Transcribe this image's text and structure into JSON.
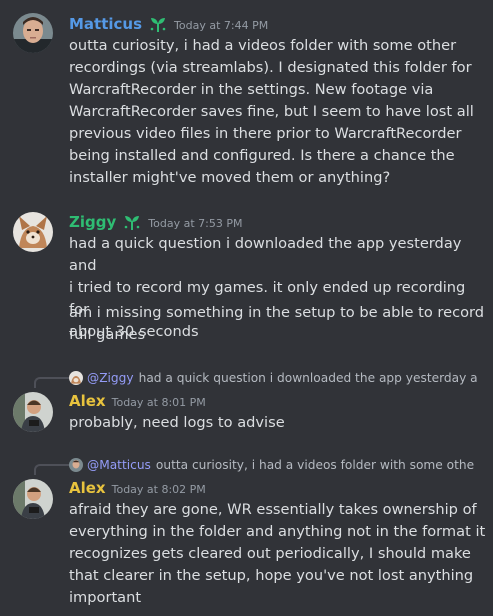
{
  "colors": {
    "background": "#313338",
    "matticus": "#5599e6",
    "ziggy": "#2fbd73",
    "alex": "#e8c33e",
    "timestamp": "#949ba4",
    "text": "#dbdee1",
    "mention": "#949cf7"
  },
  "messages": [
    {
      "author": "Matticus",
      "badge": "sprout-icon",
      "timestamp": "Today at 7:44 PM",
      "lines": [
        "outta curiosity, i had a videos folder with some other",
        "recordings (via streamlabs). I designated this folder for",
        "WarcraftRecorder in the settings. New footage via",
        "WarcraftRecorder saves fine, but I seem to have lost all",
        "previous video files in there prior to WarcraftRecorder",
        "being installed and configured. Is there a chance the",
        "installer might've moved them or anything?"
      ]
    },
    {
      "author": "Ziggy",
      "badge": "sprout-icon",
      "timestamp": "Today at 7:53 PM",
      "lines": [
        "had a quick question i downloaded the app yesterday and",
        "i tried to record my games. it only ended up recording for",
        "about 30 seconds"
      ],
      "followup": [
        "am i missing something in the setup to be able to record",
        "full games"
      ]
    },
    {
      "author": "Alex",
      "timestamp": "Today at 8:01 PM",
      "reply_to": {
        "name": "@Ziggy",
        "text": "had a quick question i downloaded the app yesterday a"
      },
      "lines": [
        "probably, need logs to advise"
      ]
    },
    {
      "author": "Alex",
      "timestamp": "Today at 8:02 PM",
      "reply_to": {
        "name": "@Matticus",
        "text": "outta curiosity, i had a videos folder with some othe"
      },
      "lines": [
        "afraid they are gone, WR essentially takes ownership of",
        "everything in the folder and anything not in the format it",
        "recognizes gets cleared out periodically, I should make",
        "that clearer in the setup, hope you've not lost anything",
        "important"
      ]
    }
  ]
}
